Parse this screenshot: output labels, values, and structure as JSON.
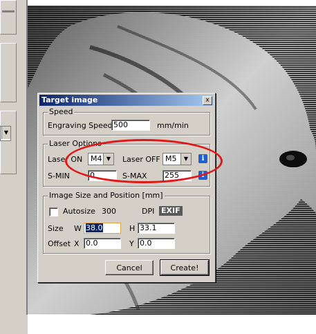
{
  "dialog": {
    "title": "Target image",
    "close_glyph": "x",
    "speed": {
      "group_label": "Speed",
      "engraving_label": "Engraving Speed",
      "engraving_value": "500",
      "unit": "mm/min"
    },
    "laser": {
      "group_label": "Laser Options",
      "on_label": "Laser ON",
      "on_value": "M4",
      "off_label": "Laser OFF",
      "off_value": "M5",
      "smin_label": "S-MIN",
      "smin_value": "0",
      "smax_label": "S-MAX",
      "smax_value": "255",
      "info_glyph": "i"
    },
    "size": {
      "group_label": "Image Size and Position [mm]",
      "autosize_label": "Autosize",
      "dpi_value": "300",
      "dpi_label": "DPI",
      "exif_label": "EXIF",
      "size_label": "Size",
      "w_label": "W",
      "w_value": "38.0",
      "h_label": "H",
      "h_value": "33.1",
      "offset_label": "Offset",
      "x_label": "X",
      "x_value": "0.0",
      "y_label": "Y",
      "y_value": "0.0"
    },
    "buttons": {
      "cancel": "Cancel",
      "create": "Create!"
    }
  },
  "left_panel": {
    "combo_arrow": "▼"
  },
  "colors": {
    "annotation": "#e01818",
    "title_bar": "#0a246a",
    "info_button": "#1f5fd0"
  }
}
